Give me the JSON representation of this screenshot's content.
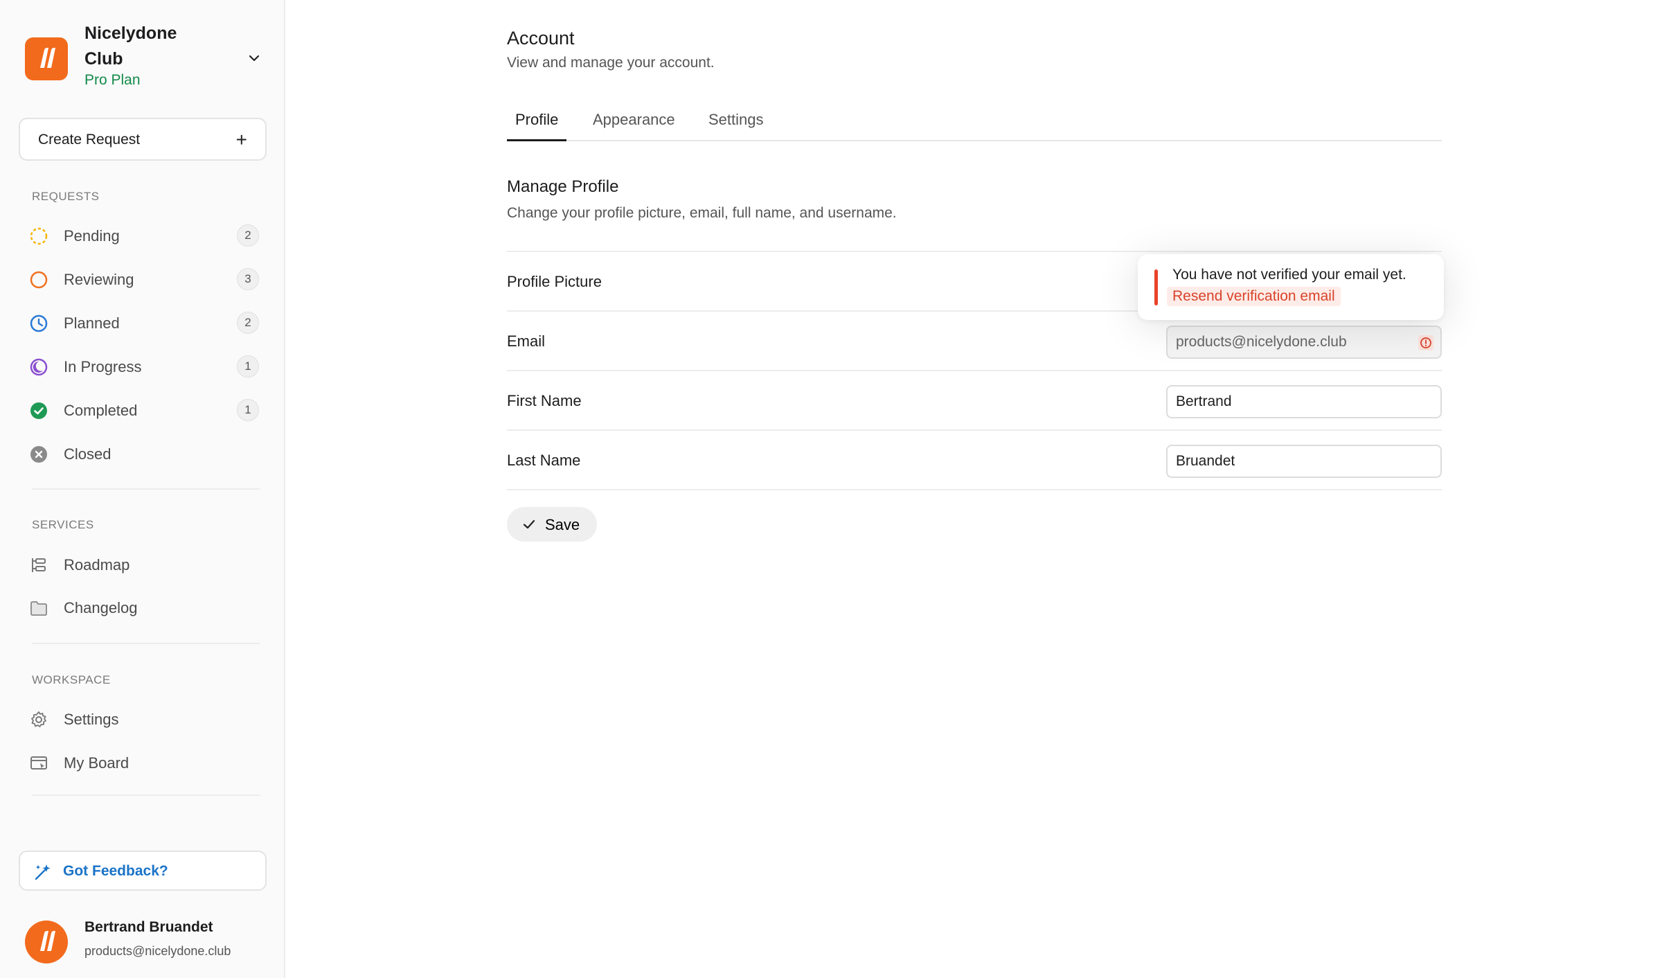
{
  "workspace": {
    "name": "Nicelydone Club",
    "plan": "Pro Plan"
  },
  "sidebar": {
    "create_request": "Create Request",
    "requests_title": "REQUESTS",
    "requests": [
      {
        "label": "Pending",
        "count": "2",
        "icon": "pending-icon"
      },
      {
        "label": "Reviewing",
        "count": "3",
        "icon": "reviewing-icon"
      },
      {
        "label": "Planned",
        "count": "2",
        "icon": "planned-clock-icon"
      },
      {
        "label": "In Progress",
        "count": "1",
        "icon": "in-progress-icon"
      },
      {
        "label": "Completed",
        "count": "1",
        "icon": "completed-check-icon"
      },
      {
        "label": "Closed",
        "icon": "closed-x-icon"
      }
    ],
    "services_title": "SERVICES",
    "services": [
      {
        "label": "Roadmap",
        "icon": "roadmap-icon"
      },
      {
        "label": "Changelog",
        "icon": "changelog-folder-icon"
      }
    ],
    "workspace_title": "WORKSPACE",
    "workspace_items": [
      {
        "label": "Settings",
        "icon": "gear-icon"
      },
      {
        "label": "My Board",
        "icon": "board-icon"
      }
    ],
    "feedback": "Got Feedback?",
    "user": {
      "name": "Bertrand Bruandet",
      "email": "products@nicelydone.club"
    }
  },
  "main": {
    "title": "Account",
    "subtitle": "View and manage your account.",
    "tabs": [
      {
        "label": "Profile",
        "active": true
      },
      {
        "label": "Appearance",
        "active": false
      },
      {
        "label": "Settings",
        "active": false
      }
    ],
    "section_title": "Manage Profile",
    "section_desc": "Change your profile picture, email, full name, and username.",
    "fields": {
      "profile_picture": "Profile Picture",
      "email_label": "Email",
      "email_value": "products@nicelydone.club",
      "first_name_label": "First Name",
      "first_name_value": "Bertrand",
      "last_name_label": "Last Name",
      "last_name_value": "Bruandet"
    },
    "save": "Save"
  },
  "toast": {
    "message": "You have not verified your email yet.",
    "action": "Resend verification email"
  },
  "colors": {
    "brand": "#f26a1c",
    "accent_link": "#1a73c8",
    "plan": "#148a4a",
    "alert": "#e8432a"
  }
}
